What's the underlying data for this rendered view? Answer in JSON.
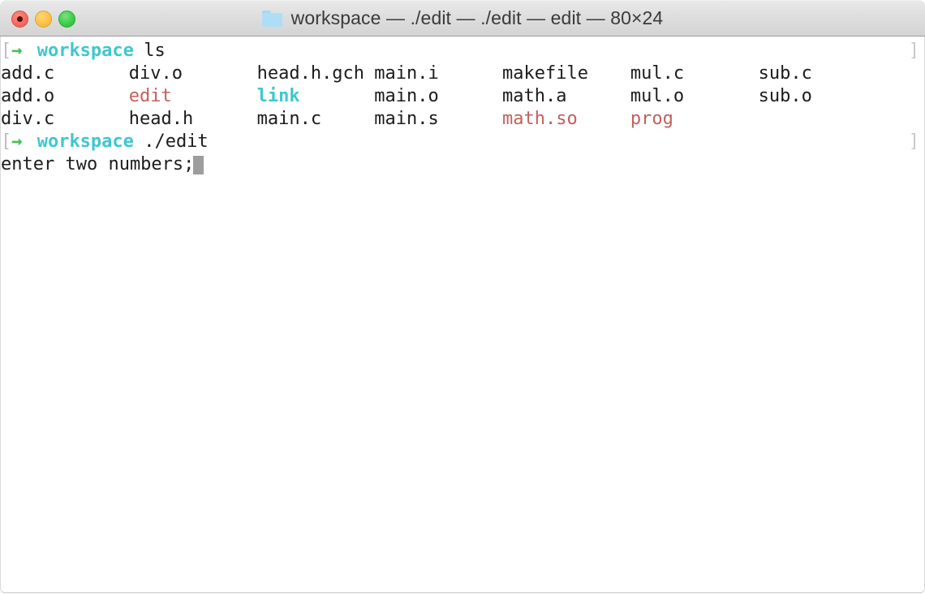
{
  "window": {
    "title": "workspace — ./edit — ./edit — edit — 80×24",
    "folder_icon": "folder-icon",
    "controls": {
      "close_label": "close",
      "minimize_label": "minimize",
      "zoom_label": "zoom"
    }
  },
  "terminal": {
    "dimensions": "80×24",
    "colors": {
      "background": "#ffffff",
      "foreground": "#1c1c1c",
      "cyan": "#3fc7cf",
      "red": "#c4605a",
      "green": "#3fc24a",
      "bracket_gray": "#bdbdbd",
      "cursor": "#9d9d9d"
    },
    "prompt": {
      "open_bracket": "[",
      "arrow": "→",
      "host": "workspace",
      "close_bracket": "]"
    },
    "lines": [
      {
        "type": "prompt",
        "command": "ls",
        "right_bracket": "]"
      },
      {
        "type": "output",
        "cells": [
          {
            "col": 0,
            "text": "add.c",
            "color": "default"
          },
          {
            "col": 12,
            "text": "div.o",
            "color": "default"
          },
          {
            "col": 24,
            "text": "head.h.gch",
            "color": "default"
          },
          {
            "col": 35,
            "text": "main.i",
            "color": "default"
          },
          {
            "col": 47,
            "text": "makefile",
            "color": "default"
          },
          {
            "col": 59,
            "text": "mul.c",
            "color": "default"
          },
          {
            "col": 71,
            "text": "sub.c",
            "color": "default"
          }
        ]
      },
      {
        "type": "output",
        "cells": [
          {
            "col": 0,
            "text": "add.o",
            "color": "default"
          },
          {
            "col": 12,
            "text": "edit",
            "color": "red"
          },
          {
            "col": 24,
            "text": "link",
            "color": "cyan"
          },
          {
            "col": 35,
            "text": "main.o",
            "color": "default"
          },
          {
            "col": 47,
            "text": "math.a",
            "color": "default"
          },
          {
            "col": 59,
            "text": "mul.o",
            "color": "default"
          },
          {
            "col": 71,
            "text": "sub.o",
            "color": "default"
          }
        ]
      },
      {
        "type": "output",
        "cells": [
          {
            "col": 0,
            "text": "div.c",
            "color": "default"
          },
          {
            "col": 12,
            "text": "head.h",
            "color": "default"
          },
          {
            "col": 24,
            "text": "main.c",
            "color": "default"
          },
          {
            "col": 35,
            "text": "main.s",
            "color": "default"
          },
          {
            "col": 47,
            "text": "math.so",
            "color": "red"
          },
          {
            "col": 59,
            "text": "prog",
            "color": "red"
          }
        ]
      },
      {
        "type": "prompt",
        "command": "./edit",
        "right_bracket": "]"
      },
      {
        "type": "output-cursor",
        "text": "enter two numbers;"
      }
    ]
  }
}
